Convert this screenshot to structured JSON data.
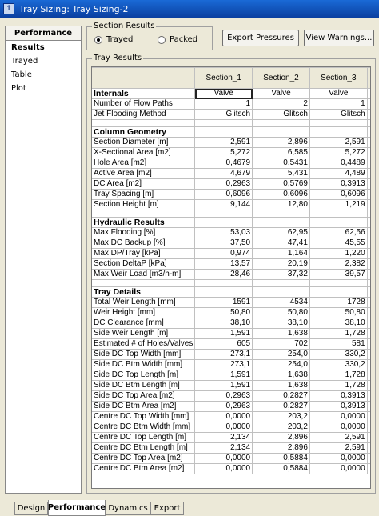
{
  "window": {
    "title": "Tray Sizing: Tray Sizing-2"
  },
  "left_nav": {
    "header": "Performance",
    "items": [
      {
        "label": "Results",
        "active": true
      },
      {
        "label": "Trayed",
        "active": false
      },
      {
        "label": "Table",
        "active": false
      },
      {
        "label": "Plot",
        "active": false
      }
    ]
  },
  "section_results": {
    "legend": "Section Results",
    "options": [
      {
        "label": "Trayed",
        "selected": true
      },
      {
        "label": "Packed",
        "selected": false
      }
    ]
  },
  "buttons": {
    "export_pressures": "Export Pressures",
    "view_warnings": "View Warnings..."
  },
  "tray_results": {
    "legend": "Tray Results",
    "columns": [
      "Section_1",
      "Section_2",
      "Section_3"
    ],
    "rows": [
      {
        "type": "group",
        "label": "Internals",
        "values": [
          "Valve",
          "Valve",
          "Valve"
        ]
      },
      {
        "label": "Number of Flow Paths",
        "values": [
          "1",
          "2",
          "1"
        ]
      },
      {
        "label": "Jet Flooding Method",
        "values": [
          "Glitsch",
          "Glitsch",
          "Glitsch"
        ]
      },
      {
        "type": "empty"
      },
      {
        "type": "group",
        "label": "Column Geometry",
        "values": [
          "",
          "",
          ""
        ]
      },
      {
        "label": "Section Diameter [m]",
        "values": [
          "2,591",
          "2,896",
          "2,591"
        ]
      },
      {
        "label": "X-Sectional Area [m2]",
        "values": [
          "5,272",
          "6,585",
          "5,272"
        ]
      },
      {
        "label": "Hole Area [m2]",
        "values": [
          "0,4679",
          "0,5431",
          "0,4489"
        ]
      },
      {
        "label": "Active Area [m2]",
        "values": [
          "4,679",
          "5,431",
          "4,489"
        ]
      },
      {
        "label": "DC Area [m2]",
        "values": [
          "0,2963",
          "0,5769",
          "0,3913"
        ]
      },
      {
        "label": "Tray Spacing [m]",
        "values": [
          "0,6096",
          "0,6096",
          "0,6096"
        ]
      },
      {
        "label": "Section Height [m]",
        "values": [
          "9,144",
          "12,80",
          "1,219"
        ]
      },
      {
        "type": "empty"
      },
      {
        "type": "group",
        "label": "Hydraulic Results",
        "values": [
          "",
          "",
          ""
        ]
      },
      {
        "label": "Max Flooding [%]",
        "values": [
          "53,03",
          "62,95",
          "62,56"
        ]
      },
      {
        "label": "Max DC Backup [%]",
        "values": [
          "37,50",
          "47,41",
          "45,55"
        ]
      },
      {
        "label": "Max DP/Tray [kPa]",
        "values": [
          "0,974",
          "1,164",
          "1,220"
        ]
      },
      {
        "label": "Section DeltaP [kPa]",
        "values": [
          "13,57",
          "20,19",
          "2,382"
        ]
      },
      {
        "label": "Max Weir Load [m3/h-m]",
        "values": [
          "28,46",
          "37,32",
          "39,57"
        ]
      },
      {
        "type": "empty"
      },
      {
        "type": "group",
        "label": "Tray Details",
        "values": [
          "",
          "",
          ""
        ]
      },
      {
        "label": "Total Weir Length [mm]",
        "values": [
          "1591",
          "4534",
          "1728"
        ]
      },
      {
        "label": "Weir Height [mm]",
        "values": [
          "50,80",
          "50,80",
          "50,80"
        ]
      },
      {
        "label": "DC Clearance [mm]",
        "values": [
          "38,10",
          "38,10",
          "38,10"
        ]
      },
      {
        "label": "Side Weir Length [m]",
        "values": [
          "1,591",
          "1,638",
          "1,728"
        ]
      },
      {
        "label": "Estimated # of Holes/Valves",
        "values": [
          "605",
          "702",
          "581"
        ]
      },
      {
        "label": "Side DC Top Width [mm]",
        "values": [
          "273,1",
          "254,0",
          "330,2"
        ]
      },
      {
        "label": "Side DC Btm Width [mm]",
        "values": [
          "273,1",
          "254,0",
          "330,2"
        ]
      },
      {
        "label": "Side DC Top Length [m]",
        "values": [
          "1,591",
          "1,638",
          "1,728"
        ]
      },
      {
        "label": "Side DC Btm Length [m]",
        "values": [
          "1,591",
          "1,638",
          "1,728"
        ]
      },
      {
        "label": "Side DC Top Area [m2]",
        "values": [
          "0,2963",
          "0,2827",
          "0,3913"
        ]
      },
      {
        "label": "Side DC Btm Area [m2]",
        "values": [
          "0,2963",
          "0,2827",
          "0,3913"
        ]
      },
      {
        "label": "Centre DC Top Width [mm]",
        "values": [
          "0,0000",
          "203,2",
          "0,0000"
        ]
      },
      {
        "label": "Centre DC Btm Width [mm]",
        "values": [
          "0,0000",
          "203,2",
          "0,0000"
        ]
      },
      {
        "label": "Centre DC Top Length [m]",
        "values": [
          "2,134",
          "2,896",
          "2,591"
        ]
      },
      {
        "label": "Centre DC Btm Length [m]",
        "values": [
          "2,134",
          "2,896",
          "2,591"
        ]
      },
      {
        "label": "Centre DC Top Area [m2]",
        "values": [
          "0,0000",
          "0,5884",
          "0,0000"
        ]
      },
      {
        "label": "Centre DC Btm Area [m2]",
        "values": [
          "0,0000",
          "0,5884",
          "0,0000"
        ]
      }
    ]
  },
  "bottom_tabs": [
    {
      "label": "Design",
      "active": false
    },
    {
      "label": "Performance",
      "active": true
    },
    {
      "label": "Dynamics",
      "active": false
    },
    {
      "label": "Export",
      "active": false
    }
  ]
}
